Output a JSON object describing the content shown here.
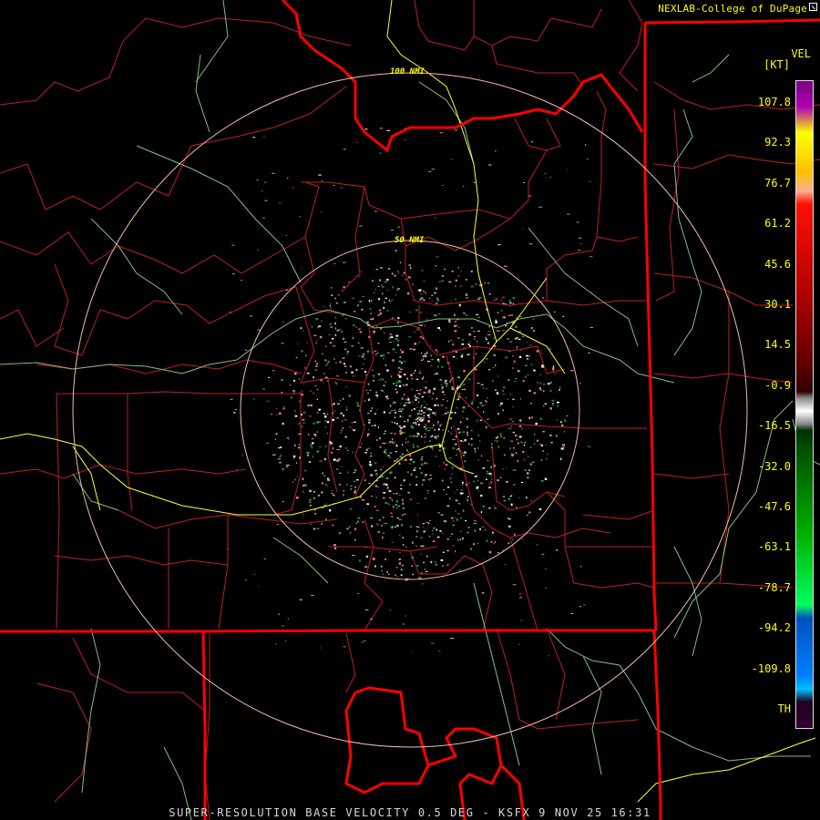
{
  "credit": "NEXLAB-College of DuPage",
  "product": "VEL",
  "units": "[KT]",
  "colorbar": {
    "labels": [
      "107.8",
      "92.3",
      "76.7",
      "61.2",
      "45.6",
      "30.1",
      "14.5",
      "-0.9",
      "-16.5",
      "-32.0",
      "-47.6",
      "-63.1",
      "-78.7",
      "-94.2",
      "-109.8",
      "TH"
    ],
    "gradient_stops": [
      [
        "#7a0083",
        0
      ],
      [
        "#b000b0",
        4
      ],
      [
        "#ffff00",
        8
      ],
      [
        "#ffc000",
        14
      ],
      [
        "#ffb090",
        17
      ],
      [
        "#ff1000",
        19
      ],
      [
        "#b00000",
        33
      ],
      [
        "#600000",
        44
      ],
      [
        "#300000",
        48
      ],
      [
        "#888888",
        49
      ],
      [
        "#ffffff",
        51
      ],
      [
        "#888888",
        53
      ],
      [
        "#003000",
        54
      ],
      [
        "#005000",
        57
      ],
      [
        "#00b000",
        70
      ],
      [
        "#00ff60",
        81
      ],
      [
        "#0050c0",
        83
      ],
      [
        "#0080ff",
        92
      ],
      [
        "#00c0ff",
        94
      ],
      [
        "#200020",
        96
      ],
      [
        "#300030",
        100
      ]
    ]
  },
  "range_rings": {
    "outer_label": "100 NMI",
    "inner_label": "50 NMI"
  },
  "caption": "SUPER-RESOLUTION BASE VELOCITY 0.5 DEG - KSFX 9 NOV 25 16:31",
  "colors": {
    "state_boundary": "#ff0000",
    "county_boundary": "#c02020",
    "river": "#80c080",
    "highway": "#ffff40",
    "range_ring": "#f0c0a0"
  }
}
